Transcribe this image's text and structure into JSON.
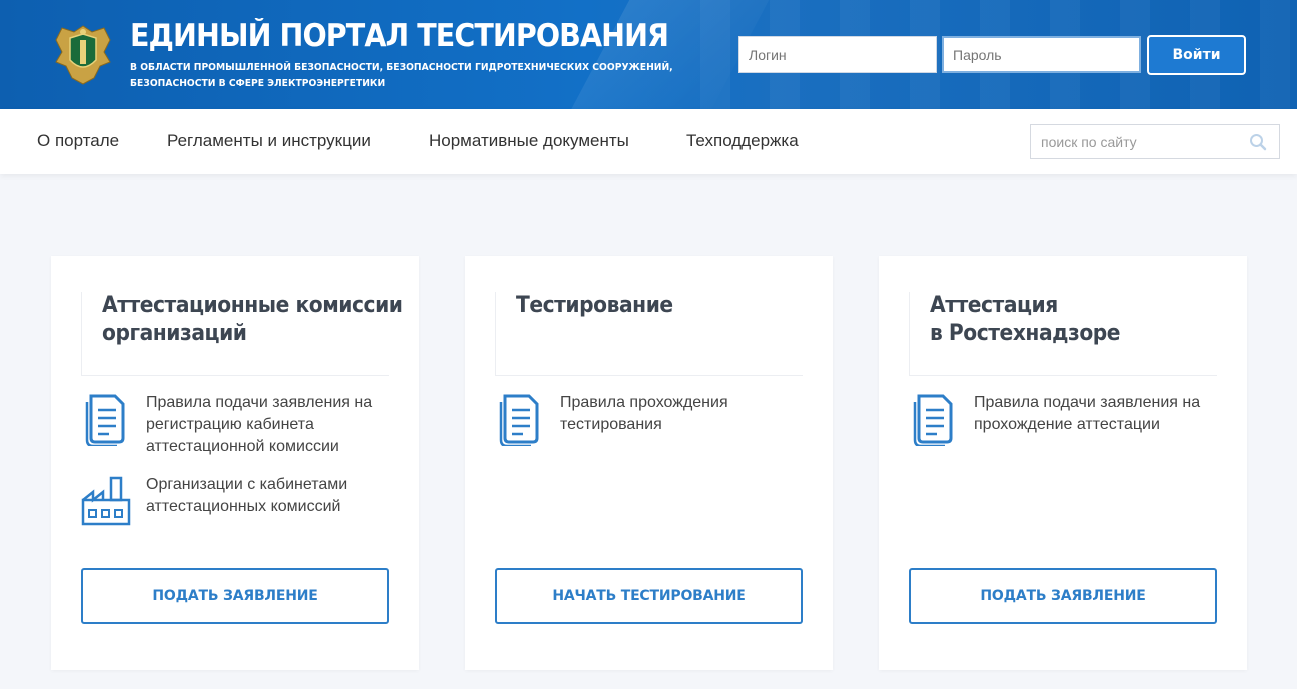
{
  "header": {
    "title": "ЕДИНЫЙ ПОРТАЛ ТЕСТИРОВАНИЯ",
    "subtitle_line1": "В ОБЛАСТИ ПРОМЫШЛЕННОЙ БЕЗОПАСНОСТИ, БЕЗОПАСНОСТИ ГИДРОТЕХНИЧЕСКИХ СООРУЖЕНИЙ,",
    "subtitle_line2": "БЕЗОПАСНОСТИ В СФЕРЕ ЭЛЕКТРОЭНЕРГЕТИКИ",
    "login_placeholder": "Логин",
    "password_placeholder": "Пароль",
    "login_button": "Войти",
    "emblem_icon": "rostekhnadzor-emblem-icon"
  },
  "nav": {
    "items": [
      "О портале",
      "Регламенты и инструкции",
      "Нормативные документы",
      "Техподдержка"
    ],
    "search_placeholder": "поиск по сайту",
    "search_icon": "search-icon"
  },
  "cards": [
    {
      "title_line1": "Аттестационные комиссии",
      "title_line2": "организаций",
      "links": [
        {
          "icon": "document-icon",
          "text": "Правила подачи заявления на регистрацию кабинета аттестационной комиссии"
        },
        {
          "icon": "factory-icon",
          "text": "Организации с кабинетами аттестационных комиссий"
        }
      ],
      "button": "ПОДАТЬ ЗАЯВЛЕНИЕ"
    },
    {
      "title_line1": "Тестирование",
      "title_line2": "",
      "links": [
        {
          "icon": "document-icon",
          "text": "Правила прохождения тестирования"
        }
      ],
      "button": "НАЧАТЬ ТЕСТИРОВАНИЕ"
    },
    {
      "title_line1": "Аттестация",
      "title_line2": "в Ростехнадзоре",
      "links": [
        {
          "icon": "document-icon",
          "text": "Правила подачи заявления на прохождение аттестации"
        }
      ],
      "button": "ПОДАТЬ ЗАЯВЛЕНИЕ"
    }
  ],
  "colors": {
    "header_blue": "#1270c7",
    "accent_blue": "#2d7ec8",
    "background": "#f4f6fa"
  }
}
